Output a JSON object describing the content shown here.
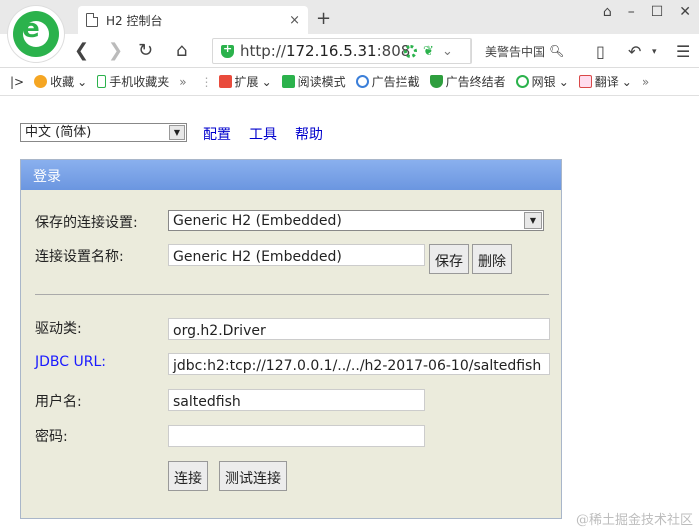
{
  "browser": {
    "tab_title": "H2 控制台",
    "tab_close": "×",
    "new_tab": "+",
    "window_buttons": [
      "⌂",
      "–",
      "☐",
      "✕"
    ],
    "url_scheme": "http://",
    "url_host": "172.16.5.31",
    "url_rest": ":808",
    "search_text": "美警告中国",
    "bookmarks": [
      {
        "label": "收藏",
        "color": "#f5a623"
      },
      {
        "label": "手机收藏夹",
        "color": "#2bb24c"
      },
      {
        "label": "扩展",
        "color": "#e94b3c"
      },
      {
        "label": "阅读模式",
        "color": "#2bb24c"
      },
      {
        "label": "广告拦截",
        "color": "#3b7fd9"
      },
      {
        "label": "广告终结者",
        "color": "#2e9e3e"
      },
      {
        "label": "网银",
        "color": "#2bb24c"
      },
      {
        "label": "翻译",
        "color": "#d94848"
      }
    ]
  },
  "toolbar": {
    "language": "中文 (简体)",
    "links": [
      "配置",
      "工具",
      "帮助"
    ]
  },
  "login": {
    "header": "登录",
    "saved_settings_label": "保存的连接设置:",
    "saved_settings_value": "Generic H2 (Embedded)",
    "setting_name_label": "连接设置名称:",
    "setting_name_value": "Generic H2 (Embedded)",
    "save_button": "保存",
    "delete_button": "删除",
    "driver_label": "驱动类:",
    "driver_value": "org.h2.Driver",
    "jdbc_label": "JDBC URL:",
    "jdbc_value": "jdbc:h2:tcp://127.0.0.1/../../h2-2017-06-10/saltedfish",
    "user_label": "用户名:",
    "user_value": "saltedfish",
    "password_label": "密码:",
    "password_value": "",
    "connect_button": "连接",
    "test_button": "测试连接"
  },
  "watermark": "@稀土掘金技术社区",
  "colors": {
    "header_bg": "#7aa4ea",
    "panel_bg": "#ebebdc",
    "link": "#0000cc",
    "brand_green": "#2bb24c"
  }
}
